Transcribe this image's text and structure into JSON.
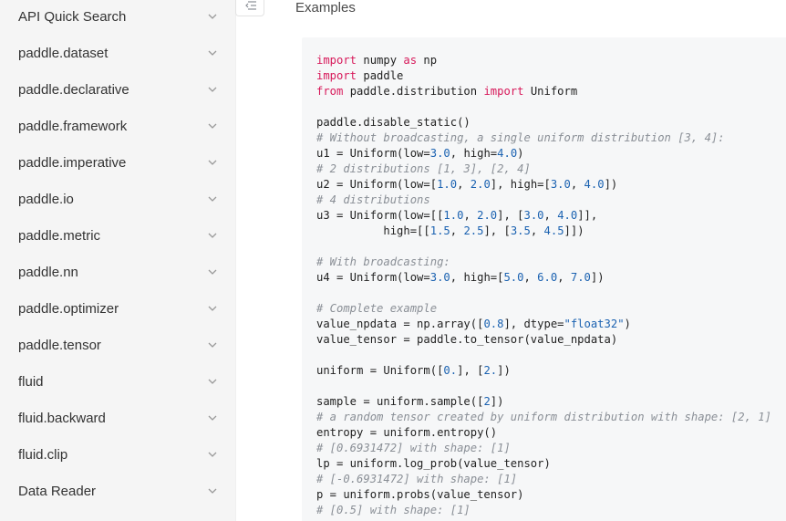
{
  "sidebar": {
    "items": [
      {
        "label": "API Quick Search"
      },
      {
        "label": "paddle.dataset"
      },
      {
        "label": "paddle.declarative"
      },
      {
        "label": "paddle.framework"
      },
      {
        "label": "paddle.imperative"
      },
      {
        "label": "paddle.io"
      },
      {
        "label": "paddle.metric"
      },
      {
        "label": "paddle.nn"
      },
      {
        "label": "paddle.optimizer"
      },
      {
        "label": "paddle.tensor"
      },
      {
        "label": "fluid"
      },
      {
        "label": "fluid.backward"
      },
      {
        "label": "fluid.clip"
      },
      {
        "label": "Data Reader"
      }
    ]
  },
  "content": {
    "section_title": "Examples",
    "code_lines": [
      [
        {
          "t": "import",
          "c": "kw"
        },
        {
          "t": " numpy "
        },
        {
          "t": "as",
          "c": "kw"
        },
        {
          "t": " np"
        }
      ],
      [
        {
          "t": "import",
          "c": "kw"
        },
        {
          "t": " paddle"
        }
      ],
      [
        {
          "t": "from",
          "c": "kw"
        },
        {
          "t": " paddle.distribution "
        },
        {
          "t": "import",
          "c": "kw"
        },
        {
          "t": " Uniform"
        }
      ],
      [],
      [
        {
          "t": "paddle.disable_static()"
        }
      ],
      [
        {
          "t": "# Without broadcasting, a single uniform distribution [3, 4]:",
          "c": "cm"
        }
      ],
      [
        {
          "t": "u1 = Uniform(low="
        },
        {
          "t": "3.0",
          "c": "num"
        },
        {
          "t": ", high="
        },
        {
          "t": "4.0",
          "c": "num"
        },
        {
          "t": ")"
        }
      ],
      [
        {
          "t": "# 2 distributions [1, 3], [2, 4]",
          "c": "cm"
        }
      ],
      [
        {
          "t": "u2 = Uniform(low=["
        },
        {
          "t": "1.0",
          "c": "num"
        },
        {
          "t": ", "
        },
        {
          "t": "2.0",
          "c": "num"
        },
        {
          "t": "], high=["
        },
        {
          "t": "3.0",
          "c": "num"
        },
        {
          "t": ", "
        },
        {
          "t": "4.0",
          "c": "num"
        },
        {
          "t": "])"
        }
      ],
      [
        {
          "t": "# 4 distributions",
          "c": "cm"
        }
      ],
      [
        {
          "t": "u3 = Uniform(low=[["
        },
        {
          "t": "1.0",
          "c": "num"
        },
        {
          "t": ", "
        },
        {
          "t": "2.0",
          "c": "num"
        },
        {
          "t": "], ["
        },
        {
          "t": "3.0",
          "c": "num"
        },
        {
          "t": ", "
        },
        {
          "t": "4.0",
          "c": "num"
        },
        {
          "t": "]],"
        }
      ],
      [
        {
          "t": "          high=[["
        },
        {
          "t": "1.5",
          "c": "num"
        },
        {
          "t": ", "
        },
        {
          "t": "2.5",
          "c": "num"
        },
        {
          "t": "], ["
        },
        {
          "t": "3.5",
          "c": "num"
        },
        {
          "t": ", "
        },
        {
          "t": "4.5",
          "c": "num"
        },
        {
          "t": "]])"
        }
      ],
      [],
      [
        {
          "t": "# With broadcasting:",
          "c": "cm"
        }
      ],
      [
        {
          "t": "u4 = Uniform(low="
        },
        {
          "t": "3.0",
          "c": "num"
        },
        {
          "t": ", high=["
        },
        {
          "t": "5.0",
          "c": "num"
        },
        {
          "t": ", "
        },
        {
          "t": "6.0",
          "c": "num"
        },
        {
          "t": ", "
        },
        {
          "t": "7.0",
          "c": "num"
        },
        {
          "t": "])"
        }
      ],
      [],
      [
        {
          "t": "# Complete example",
          "c": "cm"
        }
      ],
      [
        {
          "t": "value_npdata = np.array(["
        },
        {
          "t": "0.8",
          "c": "num"
        },
        {
          "t": "], dtype="
        },
        {
          "t": "\"float32\"",
          "c": "str"
        },
        {
          "t": ")"
        }
      ],
      [
        {
          "t": "value_tensor = paddle.to_tensor(value_npdata)"
        }
      ],
      [],
      [
        {
          "t": "uniform = Uniform(["
        },
        {
          "t": "0.",
          "c": "num"
        },
        {
          "t": "], ["
        },
        {
          "t": "2.",
          "c": "num"
        },
        {
          "t": "])"
        }
      ],
      [],
      [
        {
          "t": "sample = uniform.sample(["
        },
        {
          "t": "2",
          "c": "num"
        },
        {
          "t": "])"
        }
      ],
      [
        {
          "t": "# a random tensor created by uniform distribution with shape: [2, 1]",
          "c": "cm"
        }
      ],
      [
        {
          "t": "entropy = uniform.entropy()"
        }
      ],
      [
        {
          "t": "# [0.6931472] with shape: [1]",
          "c": "cm"
        }
      ],
      [
        {
          "t": "lp = uniform.log_prob(value_tensor)"
        }
      ],
      [
        {
          "t": "# [-0.6931472] with shape: [1]",
          "c": "cm"
        }
      ],
      [
        {
          "t": "p = uniform.probs(value_tensor)"
        }
      ],
      [
        {
          "t": "# [0.5] with shape: [1]",
          "c": "cm"
        }
      ]
    ]
  },
  "colors": {
    "keyword": "#d7195a",
    "number": "#1b62b1",
    "comment": "#8a8f96",
    "sidebar_bg": "#f5f5f5",
    "code_bg": "#f6f7f8"
  },
  "icons": {
    "toc_toggle": "outdent-list-icon",
    "sidebar_expand": "chevron-down-icon"
  }
}
